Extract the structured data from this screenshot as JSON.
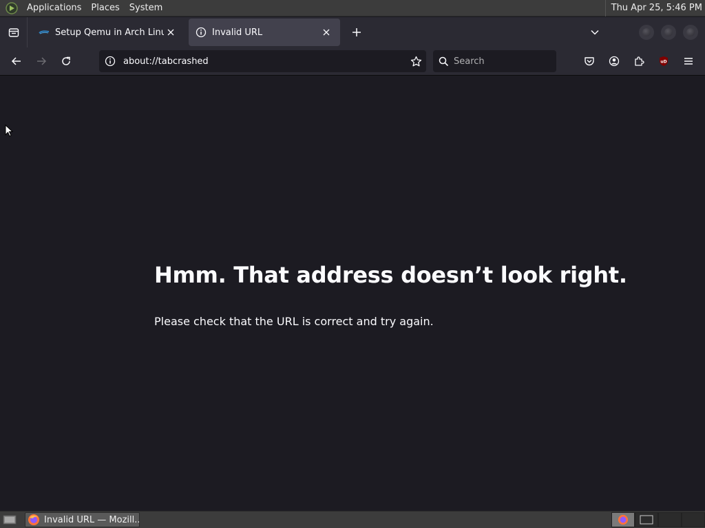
{
  "top_panel": {
    "menus": [
      "Applications",
      "Places",
      "System"
    ],
    "clock": "Thu Apr 25,  5:46 PM"
  },
  "tabs": [
    {
      "label": "Setup Qemu in Arch Linux",
      "active": false,
      "favicon": "site-favicon"
    },
    {
      "label": "Invalid URL",
      "active": true,
      "favicon": "info-icon"
    }
  ],
  "navbar": {
    "url": "about://tabcrashed",
    "search_placeholder": "Search"
  },
  "page": {
    "title": "Hmm. That address doesn’t look right.",
    "description": "Please check that the URL is correct and try again."
  },
  "taskbar": {
    "task_label": "Invalid URL — Mozill..."
  },
  "colors": {
    "content_bg": "#1c1b22",
    "toolbar_bg": "#2b2a33",
    "active_tab_bg": "#42414d",
    "panel_bg": "#3c3c3c",
    "ublock_red": "#800000"
  }
}
